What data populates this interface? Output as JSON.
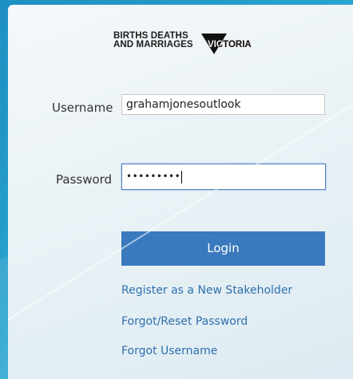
{
  "logo": {
    "line1": "BIRTHS DEATHS",
    "line2": "AND MARRIAGES",
    "line2_suffix": "VICTORIA"
  },
  "form": {
    "username_label": "Username",
    "username_value": "grahamjonesoutlook",
    "password_label": "Password",
    "password_masked": "•••••••••",
    "login_label": "Login"
  },
  "links": {
    "register": "Register as a New Stakeholder",
    "forgot_password": "Forgot/Reset Password",
    "forgot_username": "Forgot Username"
  },
  "colors": {
    "background": "#27a3cf",
    "button": "#3a79bd",
    "link": "#2f6fae"
  }
}
